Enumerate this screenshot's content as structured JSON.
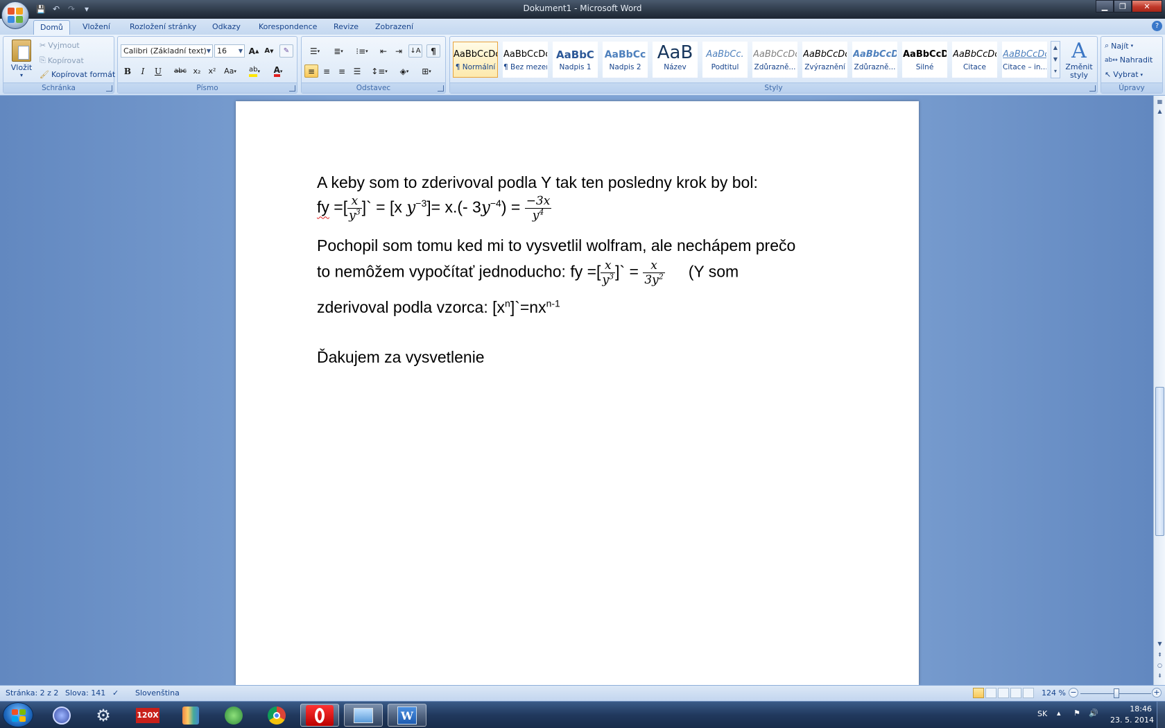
{
  "window": {
    "title": "Dokument1 - Microsoft Word",
    "controls": {
      "minimize": "▁",
      "maximize": "❐",
      "close": "✕"
    }
  },
  "qat": {
    "save": "💾",
    "undo": "↶",
    "redo": "↷",
    "customize": "▾"
  },
  "tabs": [
    "Domů",
    "Vložení",
    "Rozložení stránky",
    "Odkazy",
    "Korespondence",
    "Revize",
    "Zobrazení"
  ],
  "ribbon": {
    "clipboard": {
      "label": "Schránka",
      "paste": "Vložit",
      "cut": "Vyjmout",
      "copy": "Kopírovat",
      "format_painter": "Kopírovat formát"
    },
    "font": {
      "label": "Písmo",
      "font_name": "Calibri (Základní text)",
      "font_size": "16",
      "grow": "A",
      "shrink": "A",
      "bold": "B",
      "italic": "I",
      "underline": "U",
      "strike": "abc",
      "subscript": "x₂",
      "superscript": "x²",
      "case": "Aa",
      "highlight": "ab",
      "color": "A"
    },
    "paragraph": {
      "label": "Odstavec"
    },
    "styles": {
      "label": "Styly",
      "items": [
        {
          "sample": "AaBbCcDc",
          "name": "¶ Normální"
        },
        {
          "sample": "AaBbCcDc",
          "name": "¶ Bez mezer"
        },
        {
          "sample": "AaBbC",
          "name": "Nadpis 1"
        },
        {
          "sample": "AaBbCc",
          "name": "Nadpis 2"
        },
        {
          "sample": "AaB",
          "name": "Název"
        },
        {
          "sample": "AaBbCc.",
          "name": "Podtitul"
        },
        {
          "sample": "AaBbCcDc",
          "name": "Zdůrazně..."
        },
        {
          "sample": "AaBbCcDc",
          "name": "Zvýraznění"
        },
        {
          "sample": "AaBbCcDc",
          "name": "Zdůrazně..."
        },
        {
          "sample": "AaBbCcDc",
          "name": "Silné"
        },
        {
          "sample": "AaBbCcDc",
          "name": "Citace"
        },
        {
          "sample": "AaBbCcDc",
          "name": "Citace – in..."
        }
      ],
      "change_styles": "Změnit styly"
    },
    "editing": {
      "label": "Úpravy",
      "find": "Najít",
      "replace": "Nahradit",
      "select": "Vybrat"
    }
  },
  "document": {
    "line1": "A keby som to zderivoval podla Y tak ten posledny krok by bol:",
    "line3": "Pochopil som tomu ked mi to vysvetlil wolfram, ale nechápem prečo",
    "line4_text": "to nemôžem vypočítať jednoducho: fy =[",
    "line4_tail": "(Y som",
    "line5_text": "zderivoval podla vzorca: [x",
    "line6": "Ďakujem za vysvetlenie"
  },
  "statusbar": {
    "page": "Stránka: 2 z 2",
    "words": "Slova: 141",
    "language": "Slovenština",
    "zoom": "124 %"
  },
  "tray": {
    "lang": "SK",
    "time": "18:46",
    "date": "23. 5. 2014"
  },
  "colors": {
    "accent": "#15428b",
    "selected_style": "#fde9ad",
    "spell_underline": "#e02020"
  }
}
